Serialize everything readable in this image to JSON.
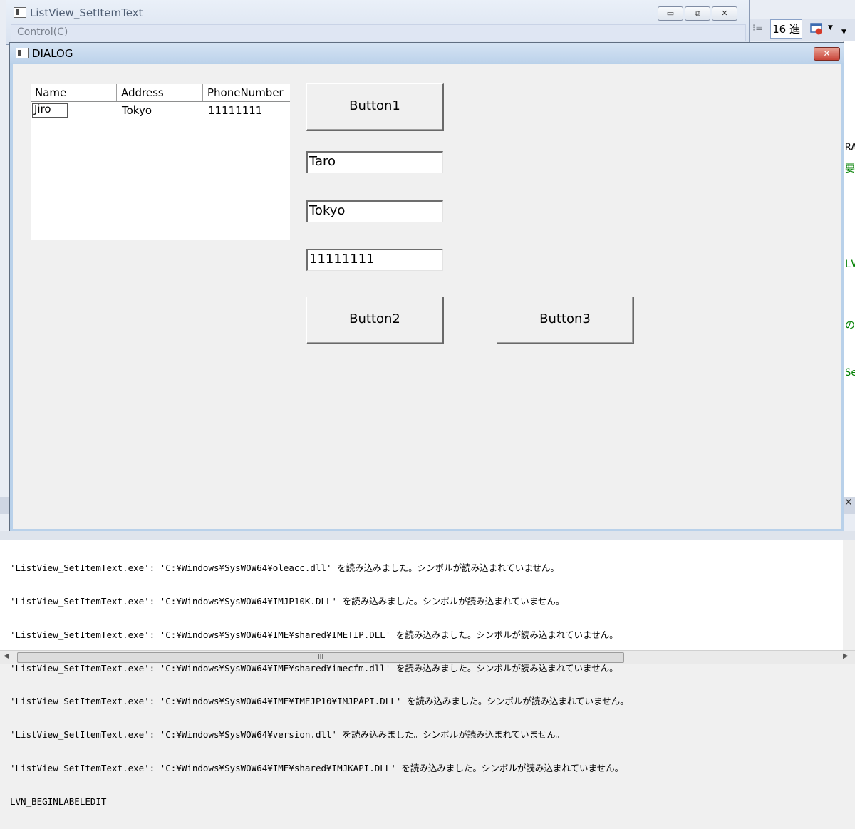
{
  "main_window": {
    "title": "ListView_SetItemText",
    "menu": "Control(C)",
    "minimize_glyph": "▭",
    "maximize_glyph": "⧉",
    "close_glyph": "✕"
  },
  "ide": {
    "toolbar_hex": "16 進",
    "right_fragments": [
      "RA",
      "要",
      "LVN",
      "の",
      "Se"
    ],
    "close_glyph": "✕"
  },
  "dialog": {
    "title": "DIALOG",
    "close_glyph": "✕",
    "listview": {
      "columns": [
        "Name",
        "Address",
        "PhoneNumber"
      ],
      "rows": [
        {
          "name": "Jiro",
          "address": "Tokyo",
          "phone": "11111111"
        }
      ]
    },
    "button1": "Button1",
    "button2": "Button2",
    "button3": "Button3",
    "edit_name": "Taro",
    "edit_address": "Tokyo",
    "edit_phone": "11111111"
  },
  "output": {
    "lines": [
      "'ListView_SetItemText.exe': 'C:¥Windows¥SysWOW64¥oleacc.dll' を読み込みました。シンボルが読み込まれていません。",
      "'ListView_SetItemText.exe': 'C:¥Windows¥SysWOW64¥IMJP10K.DLL' を読み込みました。シンボルが読み込まれていません。",
      "'ListView_SetItemText.exe': 'C:¥Windows¥SysWOW64¥IME¥shared¥IMETIP.DLL' を読み込みました。シンボルが読み込まれていません。",
      "'ListView_SetItemText.exe': 'C:¥Windows¥SysWOW64¥IME¥shared¥imecfm.dll' を読み込みました。シンボルが読み込まれていません。",
      "'ListView_SetItemText.exe': 'C:¥Windows¥SysWOW64¥IME¥IMEJP10¥IMJPAPI.DLL' を読み込みました。シンボルが読み込まれていません。",
      "'ListView_SetItemText.exe': 'C:¥Windows¥SysWOW64¥version.dll' を読み込みました。シンボルが読み込まれていません。",
      "'ListView_SetItemText.exe': 'C:¥Windows¥SysWOW64¥IME¥shared¥IMJKAPI.DLL' を読み込みました。シンボルが読み込まれていません。",
      "LVN_BEGINLABELEDIT"
    ],
    "scroll_grip": "III",
    "scroll_left": "◀",
    "scroll_right": "▶"
  }
}
